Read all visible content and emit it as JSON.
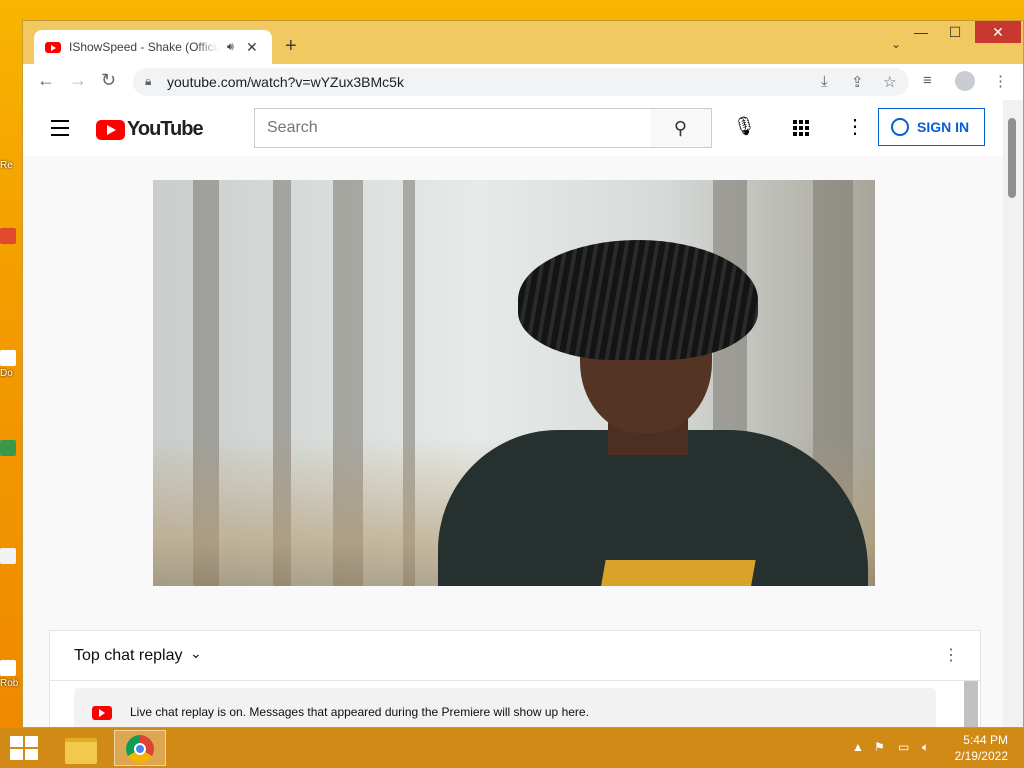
{
  "desktop": {
    "icons": [
      {
        "label": "Re",
        "color": "#ffffff"
      },
      {
        "label": "Do",
        "color": "#2a6fd8"
      },
      {
        "label": "Rob",
        "color": "#3a9a4a"
      }
    ]
  },
  "browser": {
    "tab_title": "IShowSpeed - Shake (Official",
    "tab_audio_icon": "speaker-icon",
    "new_tab_label": "+",
    "url": "youtube.com/watch?v=wYZux3BMc5k",
    "window_controls": {
      "minimize": "—",
      "maximize": "☐",
      "close": "✕"
    }
  },
  "youtube": {
    "logo_text": "YouTube",
    "search_placeholder": "Search",
    "sign_in_label": "SIGN IN",
    "accent_color": "#065fd4",
    "brand_color": "#ff0000"
  },
  "chat": {
    "title": "Top chat replay",
    "banner_text": "Live chat replay is on. Messages that appeared during the Premiere will show up here."
  },
  "taskbar": {
    "time": "5:44 PM",
    "date": "2/19/2022"
  }
}
